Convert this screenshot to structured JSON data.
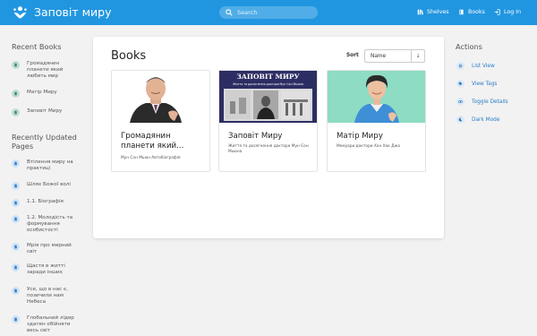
{
  "header": {
    "app_title": "Заповіт миру",
    "search_placeholder": "Search",
    "nav": [
      {
        "label": "Shelves",
        "icon": "shelves-icon"
      },
      {
        "label": "Books",
        "icon": "books-icon"
      },
      {
        "label": "Log In",
        "icon": "login-icon"
      }
    ]
  },
  "left_sidebar": {
    "recent_books_heading": "Recent Books",
    "recent_books": [
      {
        "label": "Громадянин планети який любить мир"
      },
      {
        "label": "Матір Миру"
      },
      {
        "label": "Заповіт Миру"
      }
    ],
    "recent_pages_heading": "Recently Updated Pages",
    "recent_pages": [
      {
        "label": "Втілення миру на практиці"
      },
      {
        "label": "Шлях Божої волі"
      },
      {
        "label": "1.1. Біографія"
      },
      {
        "label": "1.2. Молодість та формування особистості"
      },
      {
        "label": "Мрія про мирний світ"
      },
      {
        "label": "Щастя в житті заради інших"
      },
      {
        "label": "Усе, що в нас є, позичили нам Небеса"
      },
      {
        "label": "Глобальний лідер здатен обійняти весь світ"
      }
    ]
  },
  "main": {
    "title": "Books",
    "sort_label": "Sort",
    "sort_value": "Name",
    "sort_direction_icon": "↓",
    "books": [
      {
        "title": "Громадянин планети який...",
        "description": "Мун Сон Мьюн Автобіографія"
      },
      {
        "title": "Заповіт Миру",
        "description": "Життя та досягнення доктора Мун Сон Мьюна",
        "cover_title": "ЗАПОВІТ МИРУ",
        "cover_subtitle": "Життя та досягнення доктора Мун Сон Мьюна"
      },
      {
        "title": "Матір Миру",
        "description": "Мемуари доктори Хон Хак Джа"
      }
    ]
  },
  "right_sidebar": {
    "heading": "Actions",
    "actions": [
      {
        "label": "List View",
        "icon": "list-icon"
      },
      {
        "label": "View Tags",
        "icon": "tag-icon"
      },
      {
        "label": "Toggle Details",
        "icon": "eye-icon"
      },
      {
        "label": "Dark Mode",
        "icon": "moon-icon"
      }
    ]
  },
  "colors": {
    "header_bg": "#2196e0",
    "link": "#2a7dc9",
    "page_bg": "#f2f2f2"
  }
}
